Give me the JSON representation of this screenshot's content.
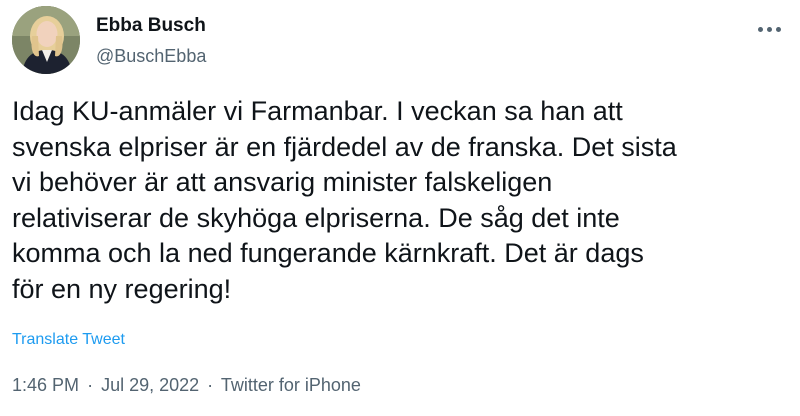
{
  "author": {
    "display_name": "Ebba Busch",
    "handle": "@BuschEbba"
  },
  "tweet": {
    "text": "Idag KU-anmäler vi Farmanbar. I veckan sa han att\nsvenska elpriser är en fjärdedel av de franska. Det sista\nvi behöver är att ansvarig minister falskeligen\nrelativiserar de skyhöga elpriserna. De såg det inte\nkomma och la ned fungerande kärnkraft. Det är dags\nför en ny regering!",
    "translate_label": "Translate Tweet",
    "time": "1:46 PM",
    "separator": "·",
    "date": "Jul 29, 2022",
    "source": "Twitter for iPhone"
  },
  "icons": {
    "avatar": "profile-photo",
    "more": "more-options-icon"
  },
  "colors": {
    "link": "#1d9bf0",
    "secondary_text": "#536471",
    "primary_text": "#0f1419"
  }
}
